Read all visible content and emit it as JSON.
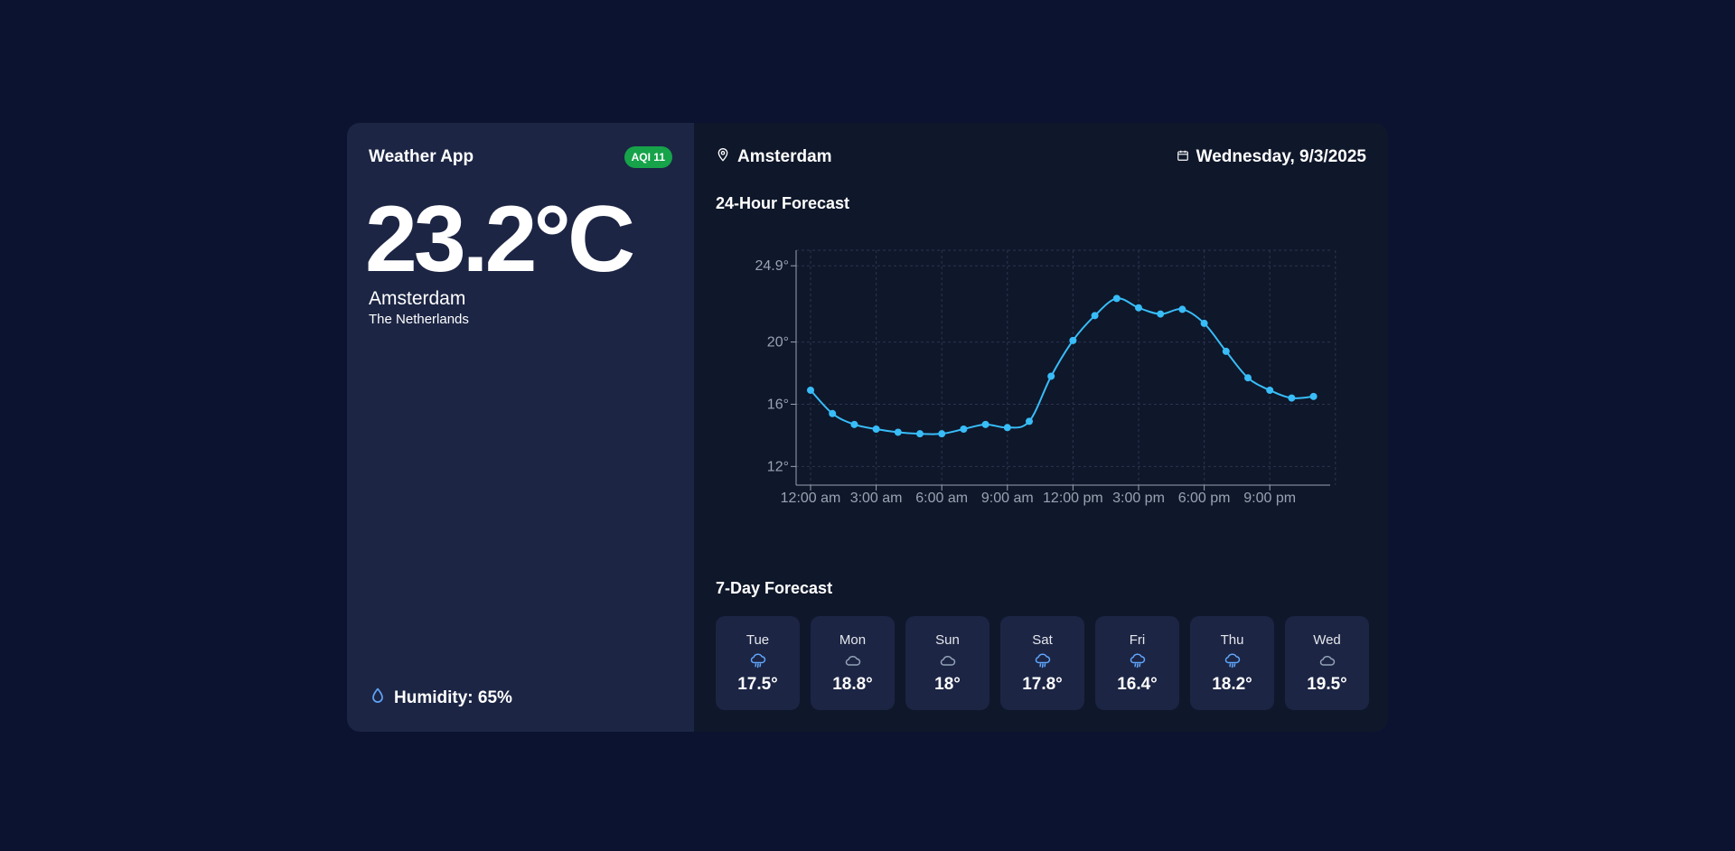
{
  "app": {
    "title": "Weather App",
    "aqi": "AQI 11"
  },
  "current": {
    "temp": "23.2°C",
    "city": "Amsterdam",
    "country": "The Netherlands",
    "humidity": "Humidity: 65%"
  },
  "header": {
    "location": "Amsterdam",
    "date": "Wednesday, 9/3/2025"
  },
  "sections": {
    "hourly_title": "24-Hour Forecast",
    "weekly_title": "7-Day Forecast"
  },
  "colors": {
    "accent": "#38bdf8",
    "aqi_badge": "#16a34a"
  },
  "chart_data": {
    "type": "line",
    "x_tick_labels": [
      "12:00 am",
      "3:00 am",
      "6:00 am",
      "9:00 am",
      "12:00 pm",
      "3:00 pm",
      "6:00 pm",
      "9:00 pm"
    ],
    "y_tick_labels": [
      "24.9°",
      "20°",
      "16°",
      "12°"
    ],
    "y_ticks": [
      24.9,
      20,
      16,
      12
    ],
    "x": [
      0,
      1,
      2,
      3,
      4,
      5,
      6,
      7,
      8,
      9,
      10,
      11,
      12,
      13,
      14,
      15,
      16,
      17,
      18,
      19,
      20,
      21,
      22,
      23
    ],
    "values": [
      16.9,
      15.4,
      14.7,
      14.4,
      14.2,
      14.1,
      14.1,
      14.4,
      14.7,
      14.5,
      14.9,
      17.8,
      20.1,
      21.7,
      22.8,
      22.2,
      21.8,
      22.1,
      21.2,
      19.4,
      17.7,
      16.9,
      16.4,
      16.5
    ],
    "xlim": [
      0,
      24
    ],
    "ylim": [
      10.8,
      25.9
    ],
    "grid": true
  },
  "forecast": [
    {
      "day": "Tue",
      "icon": "rain-cloud-icon",
      "temp": "17.5°"
    },
    {
      "day": "Mon",
      "icon": "cloud-icon",
      "temp": "18.8°"
    },
    {
      "day": "Sun",
      "icon": "cloud-icon",
      "temp": "18°"
    },
    {
      "day": "Sat",
      "icon": "rain-cloud-icon",
      "temp": "17.8°"
    },
    {
      "day": "Fri",
      "icon": "rain-cloud-icon",
      "temp": "16.4°"
    },
    {
      "day": "Thu",
      "icon": "rain-cloud-icon",
      "temp": "18.2°"
    },
    {
      "day": "Wed",
      "icon": "cloud-icon",
      "temp": "19.5°"
    }
  ]
}
